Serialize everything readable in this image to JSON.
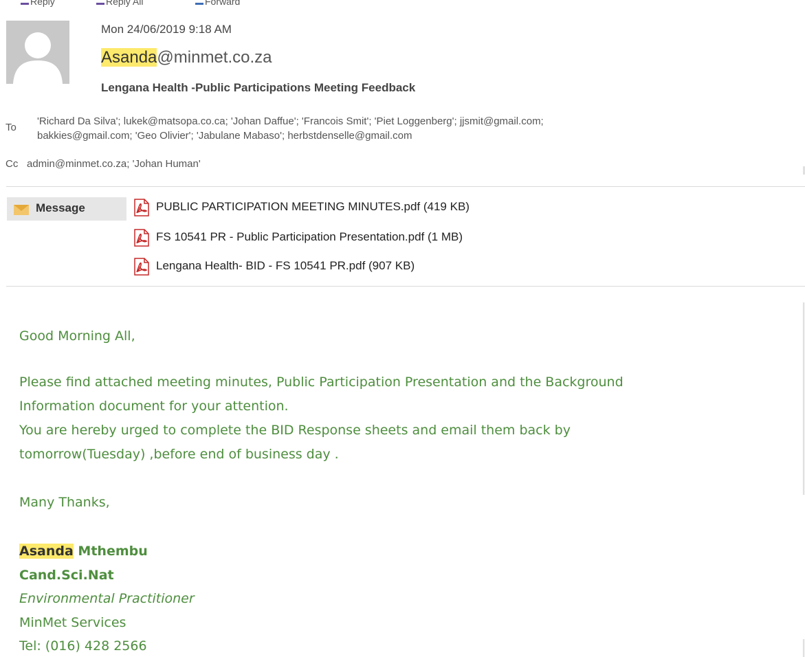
{
  "toolbar": {
    "reply_label": "Reply",
    "reply_all_label": "Reply All",
    "forward_label": "Forward"
  },
  "header": {
    "date": "Mon 24/06/2019 9:18 AM",
    "sender_name_highlight": "Asanda",
    "sender_domain": "@minmet.co.za",
    "subject": "Lengana Health -Public Participations Meeting Feedback",
    "to_label": "To",
    "to_line1": "'Richard Da Silva'; lukek@matsopa.co.ca; 'Johan Daffue'; 'Francois Smit'; 'Piet Loggenberg'; jjsmit@gmail.com;",
    "to_line2": "bakkies@gmail.com; 'Geo Olivier'; 'Jabulane Mabaso'; herbstdenselle@gmail.com",
    "cc_label": "Cc",
    "cc_text": "admin@minmet.co.za; 'Johan Human'"
  },
  "attachments": {
    "message_tab": "Message",
    "files": [
      {
        "name": "PUBLIC PARTICIPATION MEETING MINUTES.pdf (419 KB)",
        "icon": "pdf-icon"
      },
      {
        "name": "FS 10541 PR - Public Participation Presentation.pdf (1 MB)",
        "icon": "pdf-icon"
      },
      {
        "name": "Lengana Health- BID  - FS 10541 PR.pdf (907 KB)",
        "icon": "pdf-icon"
      }
    ]
  },
  "body": {
    "greeting": "Good Morning All,",
    "para1_line1": "Please find attached meeting minutes, Public Participation Presentation and the Background",
    "para1_line2": "Information document for your attention.",
    "para2_line1": "You are hereby urged to complete the BID Response sheets and email them back by",
    "para2_line2": "tomorrow(Tuesday) ,before end of business day .",
    "closing": "Many Thanks,"
  },
  "signature": {
    "first_name_highlight": "Asanda",
    "last_name": "Mthembu",
    "qualification": "Cand.Sci.Nat",
    "title": "Environmental Practitioner",
    "company": "MinMet Services",
    "tel": "Tel: (016) 428 2566"
  },
  "colors": {
    "body_green": "#4e8e3e",
    "highlight": "#fde96b",
    "pdf_red": "#c62828"
  }
}
